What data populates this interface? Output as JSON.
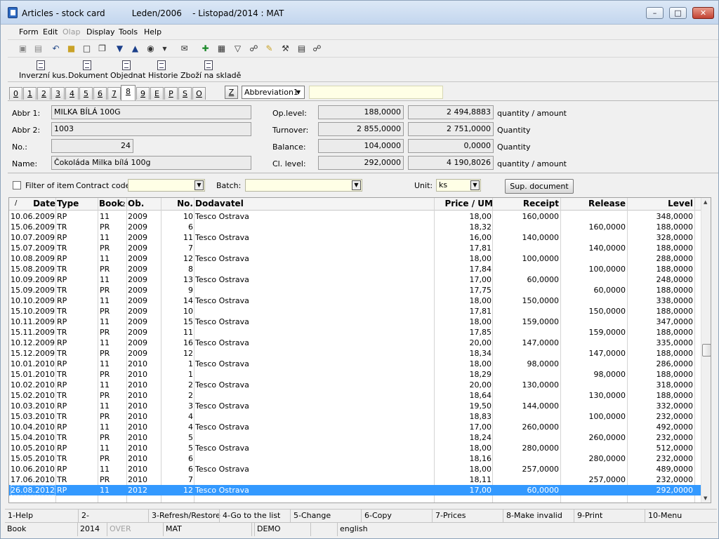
{
  "window": {
    "title": "Articles - stock card          Leden/2006    - Listopad/2014 : MAT"
  },
  "menu": [
    "Form",
    "Edit",
    "Olap",
    "Display",
    "Tools",
    "Help"
  ],
  "toolbar2": [
    "Inverzní kus.",
    "Dokument",
    "Objednat",
    "Historie",
    "Zboží na skladě"
  ],
  "tabs": [
    "0",
    "1",
    "2",
    "3",
    "4",
    "5",
    "6",
    "7",
    "8",
    "9",
    "E",
    "P",
    "S",
    "O"
  ],
  "active_tab": "8",
  "tabbar": {
    "z_label": "Z",
    "abbr_select": "Abbreviation1",
    "search_value": ""
  },
  "header": {
    "abbr1_label": "Abbr 1:",
    "abbr1": "MILKA BÍLÁ 100G",
    "abbr2_label": "Abbr 2:",
    "abbr2": "1003",
    "no_label": "No.:",
    "no": "24",
    "name_label": "Name:",
    "name": "Čokoláda Milka bílá 100g",
    "oplevel_label": "Op.level:",
    "oplevel_qty": "188,0000",
    "oplevel_amt": "2 494,8883",
    "oplevel_unit": "quantity / amount",
    "turnover_label": "Turnover:",
    "turnover_qty": "2 855,0000",
    "turnover_amt": "2 751,0000",
    "turnover_unit": "Quantity",
    "balance_label": "Balance:",
    "balance_qty": "104,0000",
    "balance_amt": "0,0000",
    "balance_unit": "Quantity",
    "cllevel_label": "Cl. level:",
    "cllevel_qty": "292,0000",
    "cllevel_amt": "4 190,8026",
    "cllevel_unit": "quantity / amount"
  },
  "filter": {
    "filter_item_label": "Filter of item",
    "contract_label": "Contract code:",
    "contract_value": "",
    "batch_label": "Batch:",
    "batch_value": "",
    "unit_label": "Unit:",
    "unit_value": "ks",
    "sup_button": "Sup. document"
  },
  "grid": {
    "columns": [
      "Date",
      "Type",
      "Book",
      "Ob.",
      "No.",
      "Dodavatel",
      "Price / UM",
      "Receipt",
      "Release",
      "Level"
    ],
    "sort_marker": "/",
    "book_marker": "2",
    "rows": [
      [
        "10.06.2009",
        "RP",
        "11",
        "2009",
        "10",
        "Tesco Ostrava",
        "18,00",
        "160,0000",
        "",
        "348,0000"
      ],
      [
        "15.06.2009",
        "TR",
        "PR",
        "2009",
        "6",
        "",
        "18,32",
        "",
        "160,0000",
        "188,0000"
      ],
      [
        "10.07.2009",
        "RP",
        "11",
        "2009",
        "11",
        "Tesco Ostrava",
        "16,00",
        "140,0000",
        "",
        "328,0000"
      ],
      [
        "15.07.2009",
        "TR",
        "PR",
        "2009",
        "7",
        "",
        "17,81",
        "",
        "140,0000",
        "188,0000"
      ],
      [
        "10.08.2009",
        "RP",
        "11",
        "2009",
        "12",
        "Tesco Ostrava",
        "18,00",
        "100,0000",
        "",
        "288,0000"
      ],
      [
        "15.08.2009",
        "TR",
        "PR",
        "2009",
        "8",
        "",
        "17,84",
        "",
        "100,0000",
        "188,0000"
      ],
      [
        "10.09.2009",
        "RP",
        "11",
        "2009",
        "13",
        "Tesco Ostrava",
        "17,00",
        "60,0000",
        "",
        "248,0000"
      ],
      [
        "15.09.2009",
        "TR",
        "PR",
        "2009",
        "9",
        "",
        "17,75",
        "",
        "60,0000",
        "188,0000"
      ],
      [
        "10.10.2009",
        "RP",
        "11",
        "2009",
        "14",
        "Tesco Ostrava",
        "18,00",
        "150,0000",
        "",
        "338,0000"
      ],
      [
        "15.10.2009",
        "TR",
        "PR",
        "2009",
        "10",
        "",
        "17,81",
        "",
        "150,0000",
        "188,0000"
      ],
      [
        "10.11.2009",
        "RP",
        "11",
        "2009",
        "15",
        "Tesco Ostrava",
        "18,00",
        "159,0000",
        "",
        "347,0000"
      ],
      [
        "15.11.2009",
        "TR",
        "PR",
        "2009",
        "11",
        "",
        "17,85",
        "",
        "159,0000",
        "188,0000"
      ],
      [
        "10.12.2009",
        "RP",
        "11",
        "2009",
        "16",
        "Tesco Ostrava",
        "20,00",
        "147,0000",
        "",
        "335,0000"
      ],
      [
        "15.12.2009",
        "TR",
        "PR",
        "2009",
        "12",
        "",
        "18,34",
        "",
        "147,0000",
        "188,0000"
      ],
      [
        "10.01.2010",
        "RP",
        "11",
        "2010",
        "1",
        "Tesco Ostrava",
        "18,00",
        "98,0000",
        "",
        "286,0000"
      ],
      [
        "15.01.2010",
        "TR",
        "PR",
        "2010",
        "1",
        "",
        "18,29",
        "",
        "98,0000",
        "188,0000"
      ],
      [
        "10.02.2010",
        "RP",
        "11",
        "2010",
        "2",
        "Tesco Ostrava",
        "20,00",
        "130,0000",
        "",
        "318,0000"
      ],
      [
        "15.02.2010",
        "TR",
        "PR",
        "2010",
        "2",
        "",
        "18,64",
        "",
        "130,0000",
        "188,0000"
      ],
      [
        "10.03.2010",
        "RP",
        "11",
        "2010",
        "3",
        "Tesco Ostrava",
        "19,50",
        "144,0000",
        "",
        "332,0000"
      ],
      [
        "15.03.2010",
        "TR",
        "PR",
        "2010",
        "4",
        "",
        "18,83",
        "",
        "100,0000",
        "232,0000"
      ],
      [
        "10.04.2010",
        "RP",
        "11",
        "2010",
        "4",
        "Tesco Ostrava",
        "17,00",
        "260,0000",
        "",
        "492,0000"
      ],
      [
        "15.04.2010",
        "TR",
        "PR",
        "2010",
        "5",
        "",
        "18,24",
        "",
        "260,0000",
        "232,0000"
      ],
      [
        "10.05.2010",
        "RP",
        "11",
        "2010",
        "5",
        "Tesco Ostrava",
        "18,00",
        "280,0000",
        "",
        "512,0000"
      ],
      [
        "15.05.2010",
        "TR",
        "PR",
        "2010",
        "6",
        "",
        "18,16",
        "",
        "280,0000",
        "232,0000"
      ],
      [
        "10.06.2010",
        "RP",
        "11",
        "2010",
        "6",
        "Tesco Ostrava",
        "18,00",
        "257,0000",
        "",
        "489,0000"
      ],
      [
        "17.06.2010",
        "TR",
        "PR",
        "2010",
        "7",
        "",
        "18,11",
        "",
        "257,0000",
        "232,0000"
      ],
      [
        "26.08.2012",
        "RP",
        "11",
        "2012",
        "12",
        "Tesco Ostrava",
        "17,00",
        "60,0000",
        "",
        "292,0000"
      ]
    ],
    "selected_index": 26
  },
  "fkeys": [
    "1-Help",
    "2-",
    "3-Refresh/Restore",
    "4-Go to the list",
    "5-Change",
    "6-Copy",
    "7-Prices",
    "8-Make invalid",
    "9-Print",
    "10-Menu"
  ],
  "status": [
    "Book",
    "2014",
    "OVER",
    "MAT",
    "",
    "DEMO",
    "",
    "english"
  ],
  "colors": {
    "selection": "#3399ff",
    "input_yellow": "#ffffe6"
  }
}
